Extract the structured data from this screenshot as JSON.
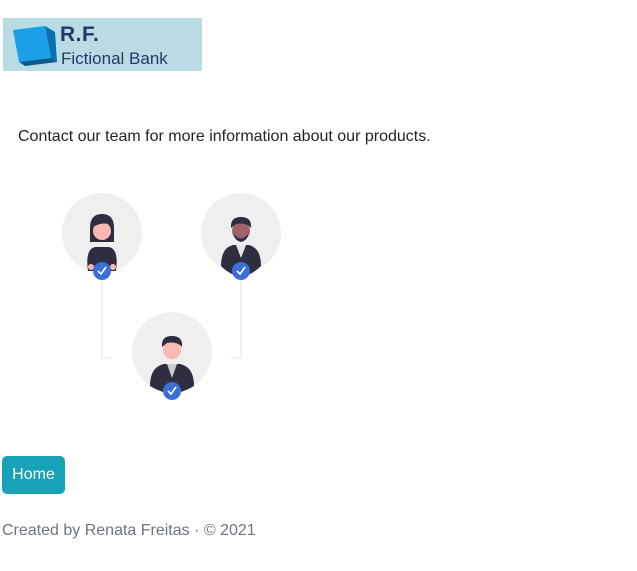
{
  "logo": {
    "line1": "R.F.",
    "line2": "Fictional Bank"
  },
  "intro_text": "Contact our team for more information about our products.",
  "home_button_label": "Home",
  "footer": {
    "text": "Created by Renata Freitas · © 2021"
  },
  "colors": {
    "logo_background": "#b9dbe4",
    "logo_text": "#1f3a6b",
    "cube": "#1aa0e6",
    "avatar_circle": "#efefef",
    "check_badge": "#3b6fd6",
    "button_background": "#17a2b8",
    "footer_text": "#6c757d"
  },
  "icons": {
    "logo_mark": "blue-cube-icon",
    "verified": "check-badge-icon"
  }
}
